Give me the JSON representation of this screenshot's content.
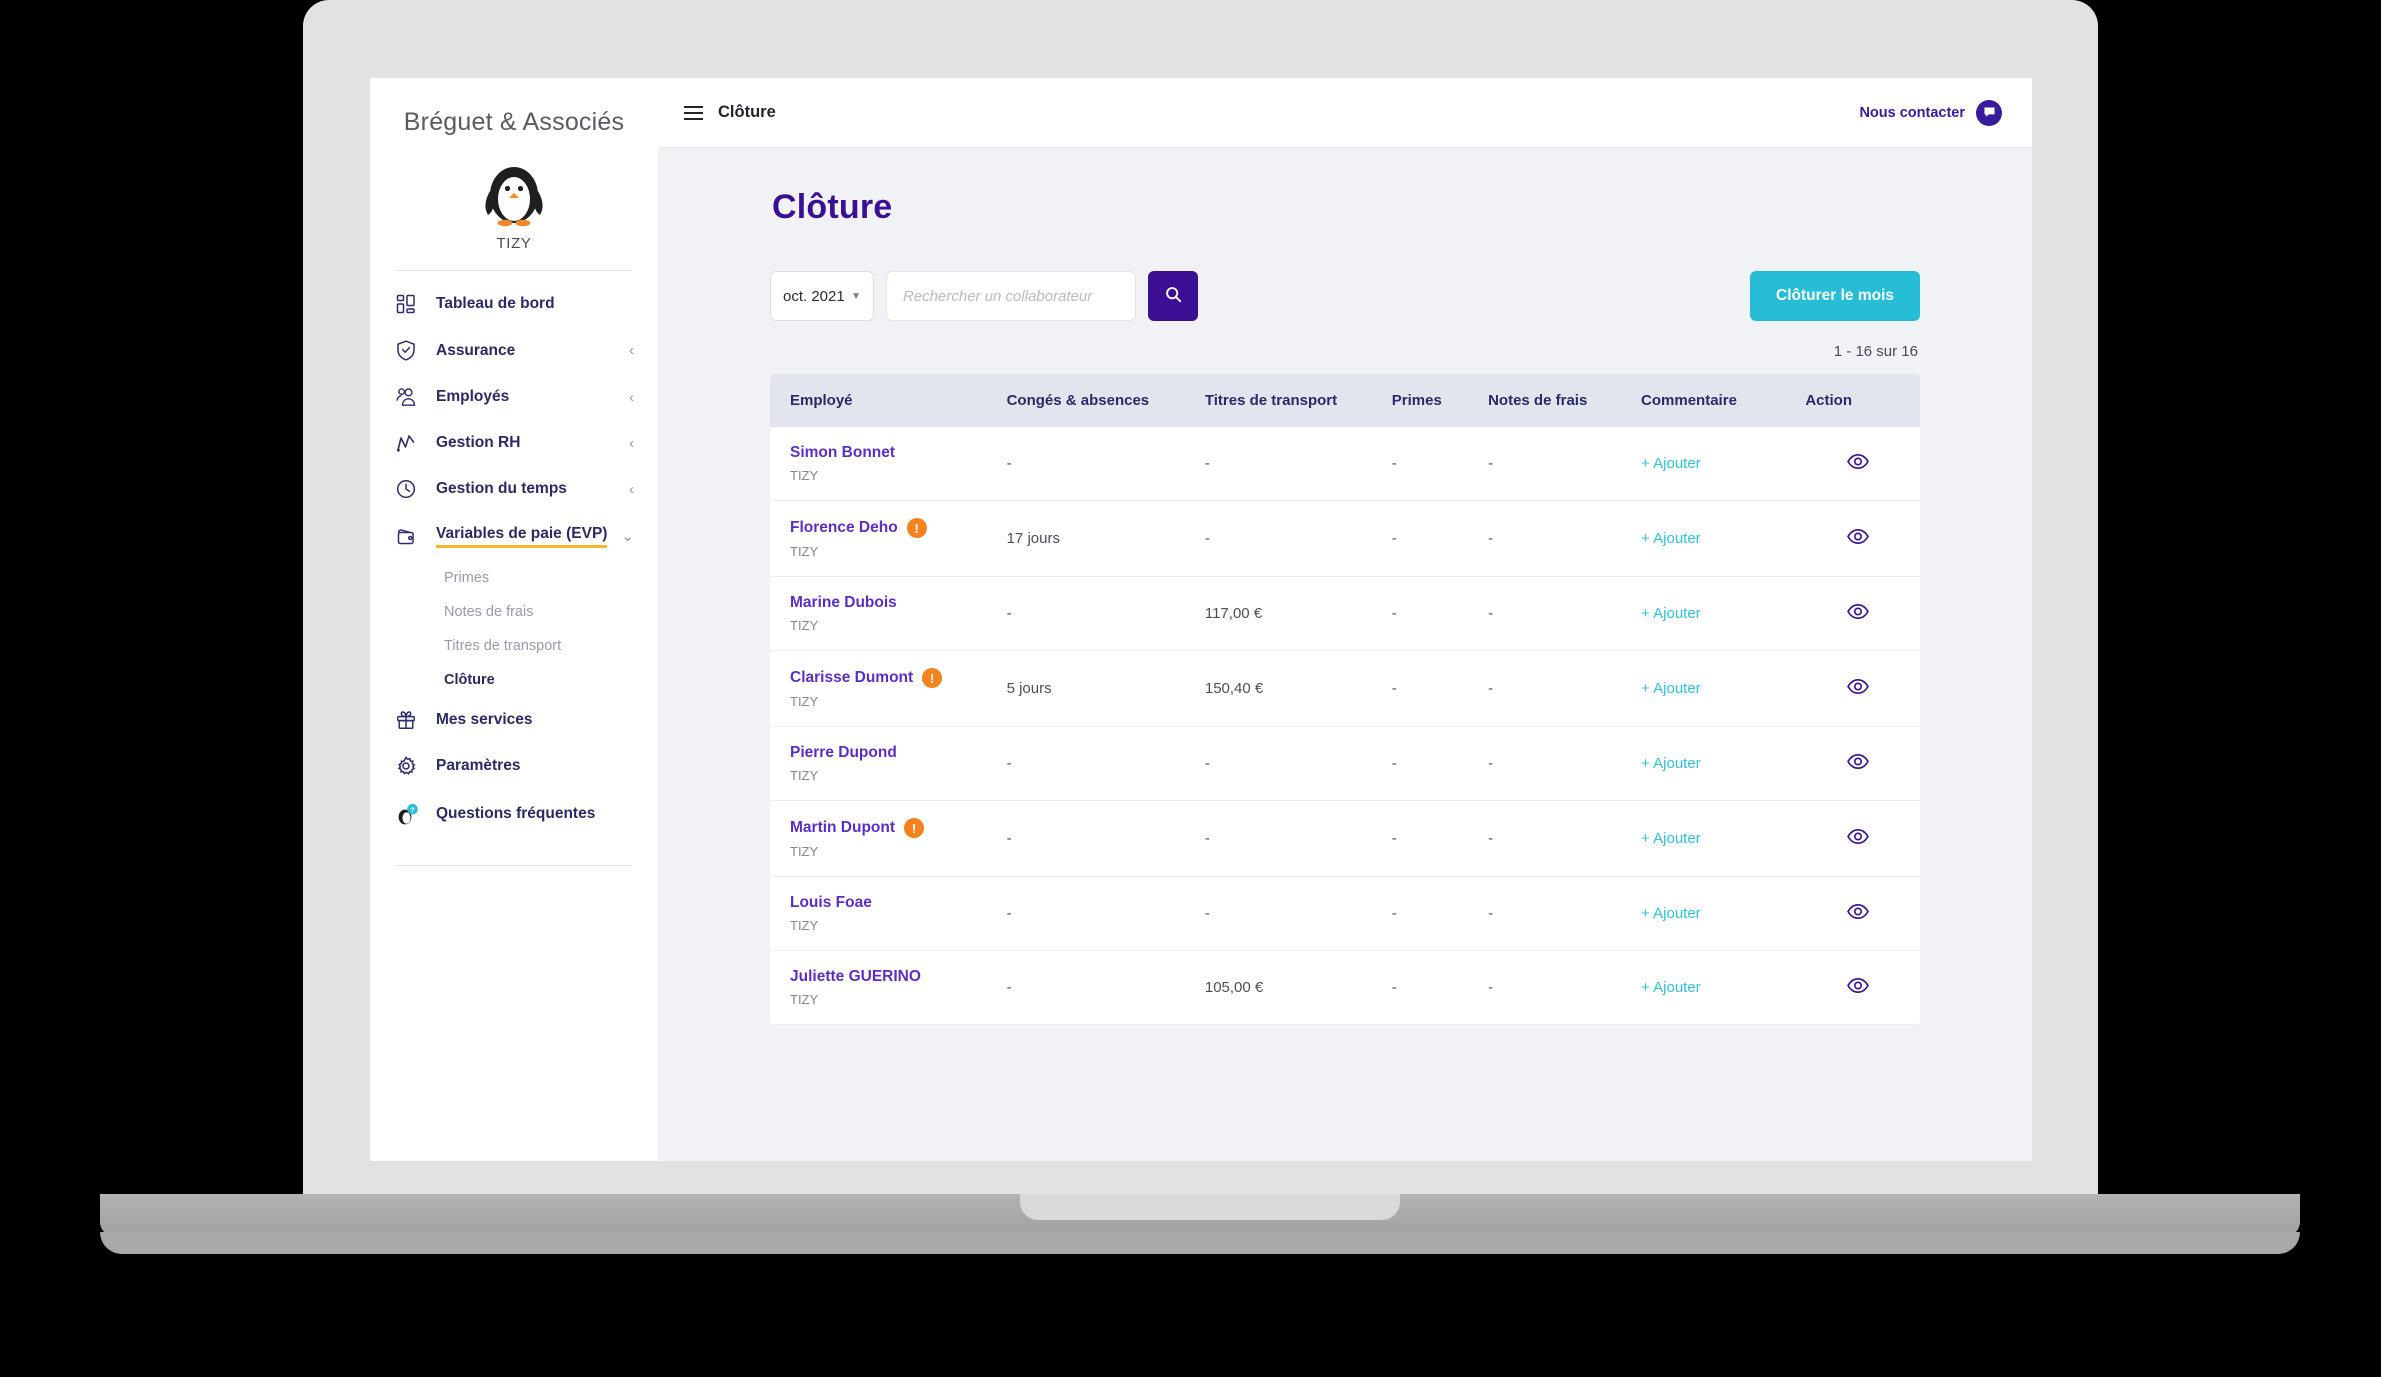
{
  "sidebar": {
    "brand_title": "Bréguet & Associés",
    "brand_sub": "TIZY",
    "items": [
      {
        "label": "Tableau de bord",
        "icon": "dashboard-icon",
        "chevron": ""
      },
      {
        "label": "Assurance",
        "icon": "shield-check-icon",
        "chevron": "‹"
      },
      {
        "label": "Employés",
        "icon": "users-icon",
        "chevron": "‹"
      },
      {
        "label": "Gestion RH",
        "icon": "chart-line-icon",
        "chevron": "‹"
      },
      {
        "label": "Gestion du temps",
        "icon": "clock-icon",
        "chevron": "‹"
      },
      {
        "label": "Variables de paie (EVP)",
        "icon": "wallet-icon",
        "chevron": "⌄"
      }
    ],
    "sub_items": [
      {
        "label": "Primes"
      },
      {
        "label": "Notes de frais"
      },
      {
        "label": "Titres de transport"
      },
      {
        "label": "Clôture"
      }
    ],
    "bottom_items": [
      {
        "label": "Mes services",
        "icon": "gift-icon"
      },
      {
        "label": "Paramètres",
        "icon": "gear-icon"
      },
      {
        "label": "Questions fréquentes",
        "icon": "penguin-help-icon"
      }
    ]
  },
  "topbar": {
    "title": "Clôture",
    "contact_label": "Nous contacter"
  },
  "page": {
    "title": "Clôture",
    "pager_count": "1 - 16 sur 16"
  },
  "filters": {
    "month_value": "oct. 2021",
    "search_placeholder": "Rechercher un collaborateur",
    "search_value": "",
    "close_month_label": "Clôturer le mois"
  },
  "table": {
    "columns": [
      "Employé",
      "Congés & absences",
      "Titres de transport",
      "Primes",
      "Notes de frais",
      "Commentaire",
      "Action"
    ],
    "add_label": "+ Ajouter",
    "rows": [
      {
        "name": "Simon Bonnet",
        "org": "TIZY",
        "warning": false,
        "conges": "-",
        "titres": "-",
        "primes": "-",
        "notes": "-"
      },
      {
        "name": "Florence Deho",
        "org": "TIZY",
        "warning": true,
        "conges": "17 jours",
        "titres": "-",
        "primes": "-",
        "notes": "-"
      },
      {
        "name": "Marine Dubois",
        "org": "TIZY",
        "warning": false,
        "conges": "-",
        "titres": "117,00 €",
        "primes": "-",
        "notes": "-"
      },
      {
        "name": "Clarisse Dumont",
        "org": "TIZY",
        "warning": true,
        "conges": "5 jours",
        "titres": "150,40 €",
        "primes": "-",
        "notes": "-"
      },
      {
        "name": "Pierre Dupond",
        "org": "TIZY",
        "warning": false,
        "conges": "-",
        "titres": "-",
        "primes": "-",
        "notes": "-"
      },
      {
        "name": "Martin Dupont",
        "org": "TIZY",
        "warning": true,
        "conges": "-",
        "titres": "-",
        "primes": "-",
        "notes": "-"
      },
      {
        "name": "Louis Foae",
        "org": "TIZY",
        "warning": false,
        "conges": "-",
        "titres": "-",
        "primes": "-",
        "notes": "-"
      },
      {
        "name": "Juliette GUERINO",
        "org": "TIZY",
        "warning": false,
        "conges": "-",
        "titres": "105,00 €",
        "primes": "-",
        "notes": "-"
      }
    ]
  },
  "colors": {
    "brand_purple": "#3a0f93",
    "nav_purple": "#2c2a66",
    "accent_cyan": "#27bdd7",
    "link_cyan": "#2fc1da",
    "warning_orange": "#f4821f",
    "active_underline": "#f5b52c",
    "name_purple": "#5b2fc7"
  }
}
